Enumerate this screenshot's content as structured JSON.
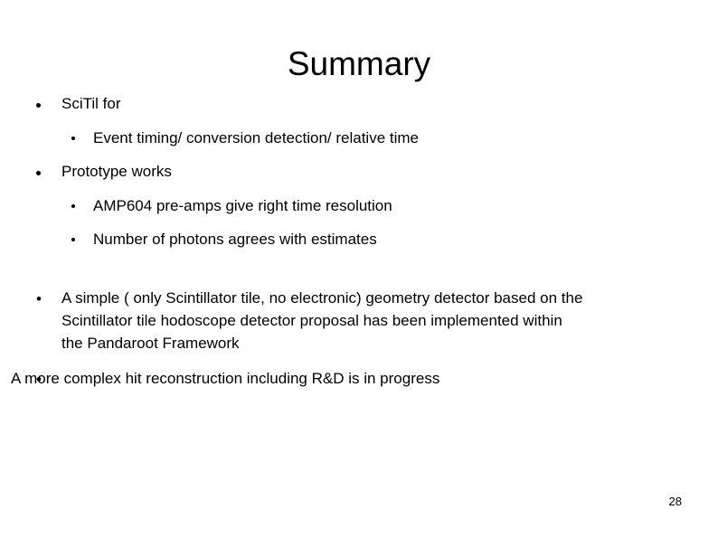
{
  "slide": {
    "title": "Summary",
    "page_number": "28",
    "background_color": "#ffffff",
    "text_color": "#000000"
  },
  "outline": [
    {
      "level": 1,
      "marker": "square-bullet",
      "text": "SciTil for"
    },
    {
      "level": 2,
      "marker": "square-bullet",
      "text": "Event timing/ conversion detection/ relative time"
    },
    {
      "level": 1,
      "marker": "square-bullet",
      "text": "Prototype works"
    },
    {
      "level": 2,
      "marker": "square-bullet",
      "text": "AMP604 pre-amps give right time resolution"
    },
    {
      "level": 2,
      "marker": "square-bullet",
      "text": "Number of photons agrees with estimates"
    }
  ],
  "paragraphs": [
    {
      "marker": "•",
      "text": "A simple ( only Scintillator tile, no electronic) geometry detector based on the Scintillator tile hodoscope detector proposal has been implemented within the Pandaroot Framework"
    },
    {
      "marker": "•",
      "text": "   A more complex hit reconstruction including R&D is in progress"
    }
  ]
}
